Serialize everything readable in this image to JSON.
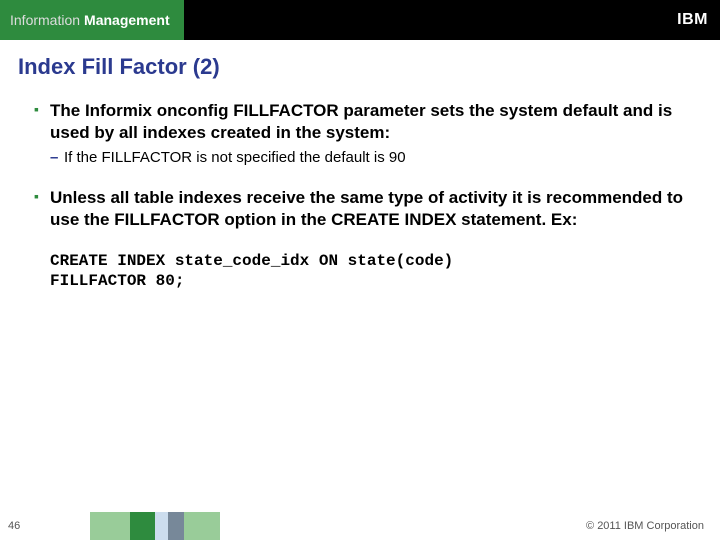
{
  "header": {
    "brand_prefix": "Information",
    "brand_word": "Management",
    "logo_text": "IBM"
  },
  "title": "Index Fill Factor (2)",
  "bullets": [
    {
      "text": "The Informix onconfig FILLFACTOR parameter sets the system default and is used by all indexes created in the system:",
      "sub": "If the FILLFACTOR is not specified the default is 90"
    },
    {
      "text": "Unless all table indexes receive the same type of activity it is recommended to use the FILLFACTOR option in the CREATE INDEX statement. Ex:",
      "sub": null
    }
  ],
  "code": {
    "line1": "CREATE INDEX state_code_idx ON state(code)",
    "line2": "FILLFACTOR 80;"
  },
  "footer": {
    "page": "46",
    "copyright": "© 2011 IBM Corporation"
  }
}
